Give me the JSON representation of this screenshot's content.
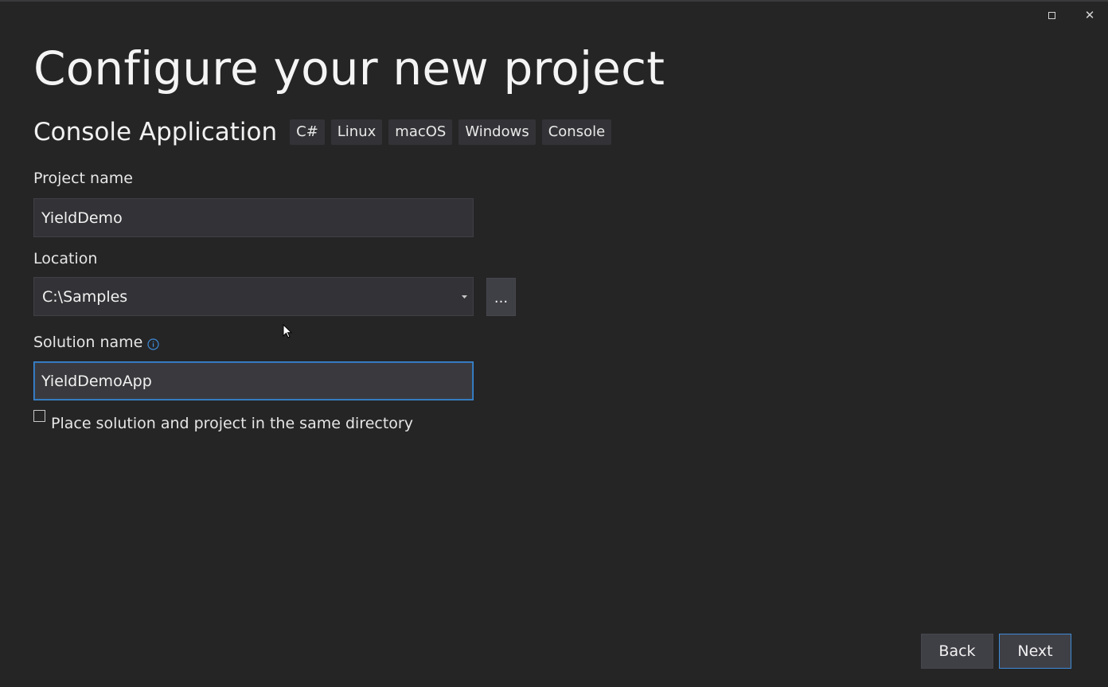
{
  "window": {
    "controls": {
      "maximize_icon": "maximize-icon",
      "close_glyph": "✕"
    }
  },
  "page": {
    "title": "Configure your new project"
  },
  "template": {
    "name": "Console Application",
    "tags": [
      "C#",
      "Linux",
      "macOS",
      "Windows",
      "Console"
    ]
  },
  "fields": {
    "project_name": {
      "label": "Project name",
      "value": "YieldDemo"
    },
    "location": {
      "label": "Location",
      "value": "C:\\Samples",
      "browse_label": "..."
    },
    "solution_name": {
      "label": "Solution name",
      "value": "YieldDemoApp",
      "info_icon": "info-icon"
    }
  },
  "options": {
    "same_directory": {
      "label": "Place solution and project in the same directory",
      "checked": false
    }
  },
  "footer": {
    "back_label": "Back",
    "next_label": "Next"
  },
  "colors": {
    "background": "#252526",
    "input_background": "#333337",
    "focus_border": "#3e8bd6",
    "info_icon": "#3e8bd6"
  }
}
